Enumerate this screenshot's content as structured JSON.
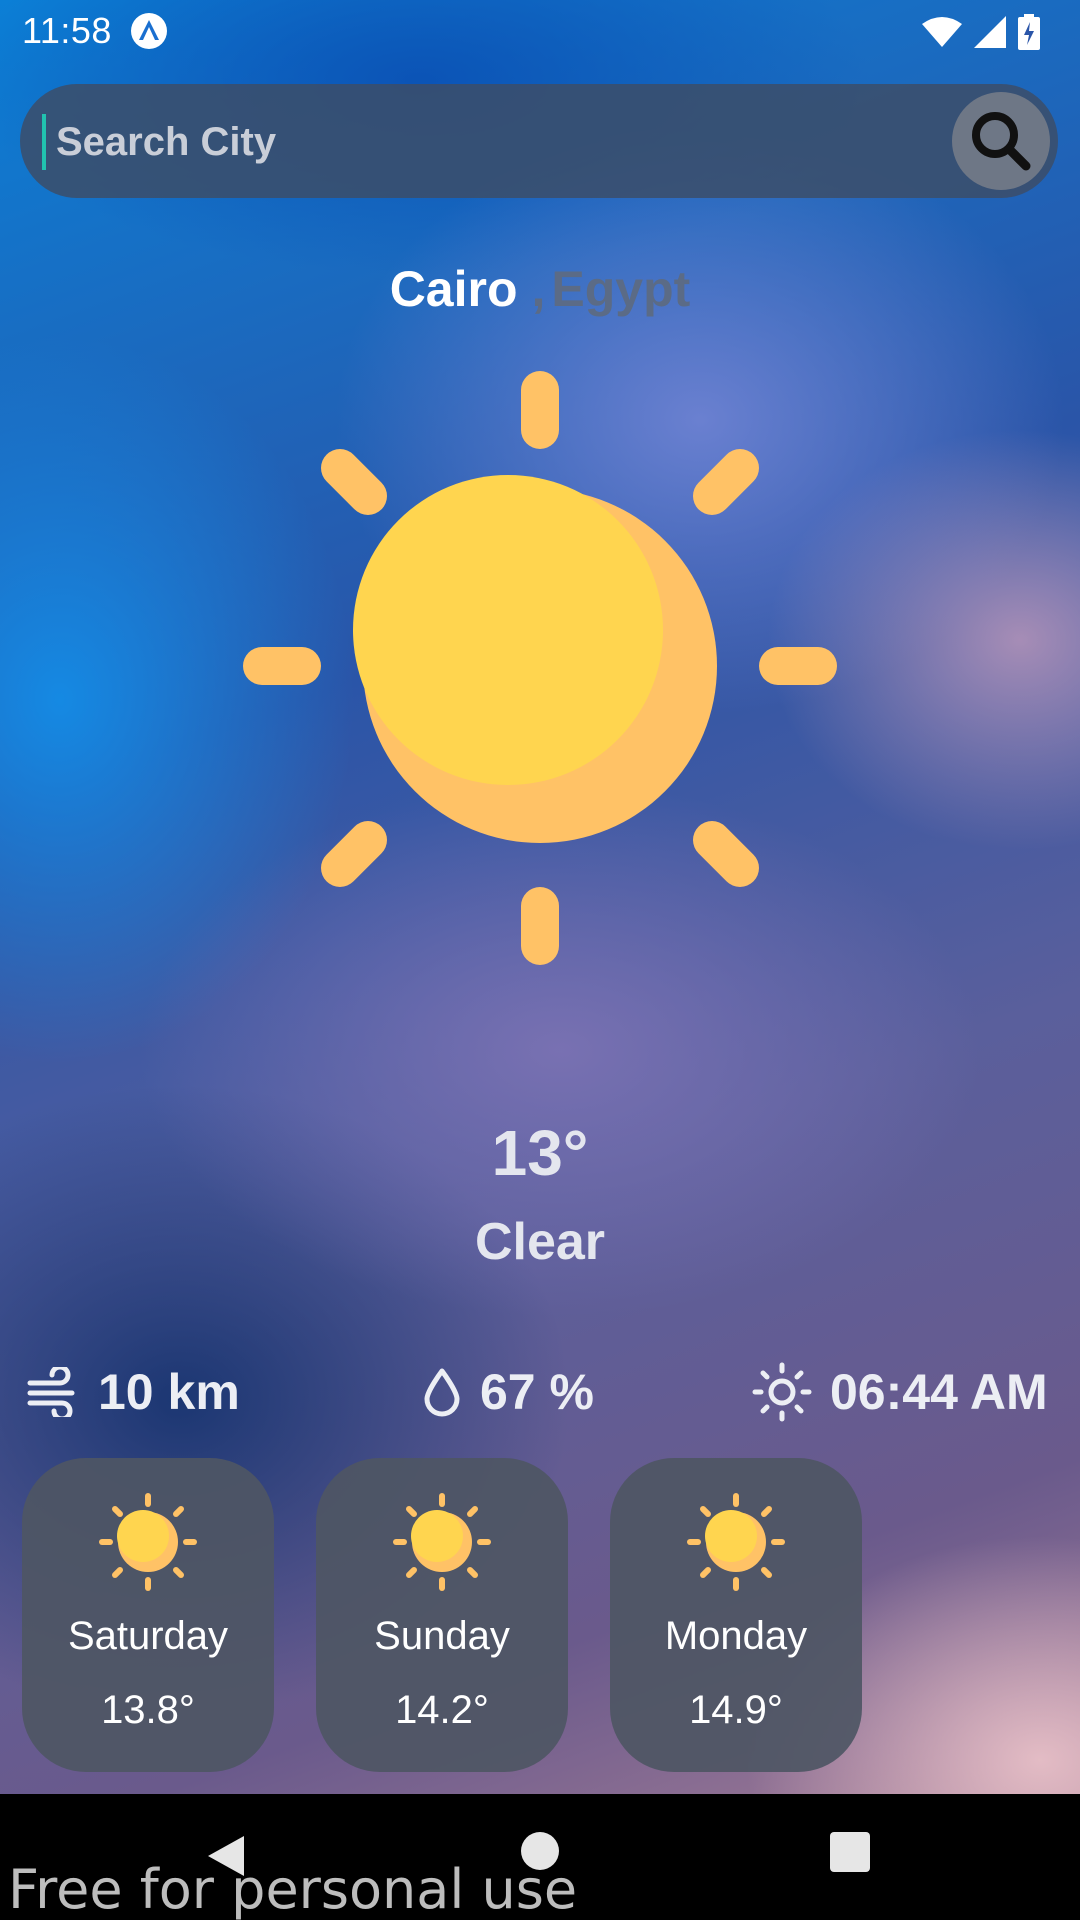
{
  "status_bar": {
    "time": "11:58"
  },
  "search": {
    "placeholder": "Search City"
  },
  "location": {
    "city": "Cairo",
    "separator": ",",
    "country": "Egypt"
  },
  "current": {
    "temperature": "13°",
    "condition": "Clear",
    "icon": "sun-icon"
  },
  "stats": {
    "wind": "10 km",
    "humidity": "67 %",
    "sunrise": "06:44 AM"
  },
  "forecast": [
    {
      "day": "Saturday",
      "temp": "13.8°",
      "icon": "sun-icon"
    },
    {
      "day": "Sunday",
      "temp": "14.2°",
      "icon": "sun-icon"
    },
    {
      "day": "Monday",
      "temp": "14.9°",
      "icon": "sun-icon"
    }
  ],
  "watermark": "Free for personal use",
  "colors": {
    "sun_main": "#FFD54F",
    "sun_shade": "#FFC266",
    "rays": "#FFC266",
    "card_bg": "#4E5664",
    "caret": "#21C2B0"
  }
}
